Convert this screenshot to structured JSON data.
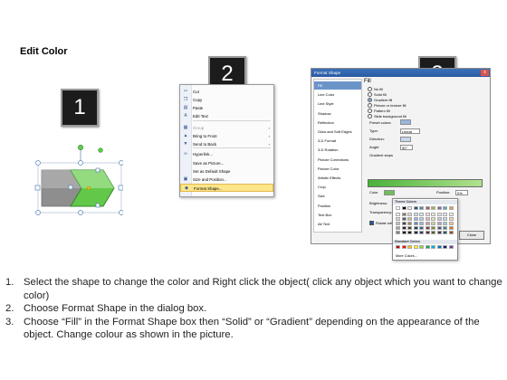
{
  "heading": "Edit Color",
  "badges": [
    "1",
    "2",
    "3"
  ],
  "shapes": {
    "left_color": "#8e8e8e",
    "right_color": "#62c84a"
  },
  "context_menu": {
    "items": [
      {
        "icon": "cut-icon",
        "glyph": "✂",
        "label": "Cut",
        "dim": false,
        "arrow": ""
      },
      {
        "icon": "copy-icon",
        "glyph": "❐",
        "label": "Copy",
        "dim": false,
        "arrow": ""
      },
      {
        "icon": "paste-icon",
        "glyph": "▤",
        "label": "Paste",
        "dim": false,
        "arrow": ""
      },
      {
        "icon": "edit-text-icon",
        "glyph": "A",
        "label": "Edit Text",
        "dim": false,
        "arrow": ""
      },
      {
        "icon": "group-icon",
        "glyph": "▦",
        "label": "Group",
        "dim": true,
        "arrow": "›"
      },
      {
        "icon": "bring-front-icon",
        "glyph": "▲",
        "label": "Bring to Front",
        "dim": false,
        "arrow": "›"
      },
      {
        "icon": "send-back-icon",
        "glyph": "▼",
        "label": "Send to Back",
        "dim": false,
        "arrow": "›"
      },
      {
        "icon": "hyperlink-icon",
        "glyph": "∞",
        "label": "Hyperlink...",
        "dim": false,
        "arrow": ""
      },
      {
        "icon": "save-picture-icon",
        "glyph": "",
        "label": "Save as Picture...",
        "dim": false,
        "arrow": ""
      },
      {
        "icon": "default-shape-icon",
        "glyph": "",
        "label": "Set as Default Shape",
        "dim": false,
        "arrow": ""
      },
      {
        "icon": "size-position-icon",
        "glyph": "▣",
        "label": "Size and Position...",
        "dim": false,
        "arrow": ""
      },
      {
        "icon": "format-shape-icon",
        "glyph": "◆",
        "label": "Format Shape...",
        "dim": false,
        "arrow": ""
      }
    ]
  },
  "dialog": {
    "title": "Format Shape",
    "close": "x",
    "side_items": [
      "Fill",
      "Line Color",
      "Line Style",
      "Shadow",
      "Reflection",
      "Glow and Soft Edges",
      "3-D Format",
      "3-D Rotation",
      "Picture Corrections",
      "Picture Color",
      "Artistic Effects",
      "Crop",
      "Size",
      "Position",
      "Text Box",
      "Alt Text"
    ],
    "pane_title": "Fill",
    "fill_options": [
      "No fill",
      "Solid fill",
      "Gradient fill",
      "Picture or texture fill",
      "Pattern fill",
      "Slide background fill"
    ],
    "selected_fill": "Gradient fill",
    "labels": {
      "preset": "Preset colors:",
      "type": "Type:",
      "type_value": "Linear",
      "direction": "Direction:",
      "angle": "Angle:",
      "angle_value": "90°",
      "stops": "Gradient stops",
      "color": "Color",
      "position": "Position:",
      "position_value": "0%",
      "brightness": "Brightness:",
      "transparency": "Transparency:",
      "rotate": "Rotate with shape"
    },
    "close_button": "Close"
  },
  "palette": {
    "theme_label": "Theme Colors",
    "standard_label": "Standard Colors",
    "more": "More Colors...",
    "theme_top": [
      "#ffffff",
      "#000000",
      "#eeece1",
      "#1f497d",
      "#4f81bd",
      "#c0504d",
      "#9bbb59",
      "#8064a2",
      "#4bacc6",
      "#f79646"
    ],
    "theme_rows": [
      [
        "#f2f2f2",
        "#7f7f7f",
        "#ddd9c3",
        "#c6d9f0",
        "#dbe5f1",
        "#f2dcdb",
        "#ebf1dd",
        "#e5e0ec",
        "#dbeef3",
        "#fdeada"
      ],
      [
        "#d8d8d8",
        "#595959",
        "#c4bd97",
        "#8db3e2",
        "#b8cce4",
        "#e5b9b7",
        "#d7e3bc",
        "#ccc1d9",
        "#b7dde8",
        "#fbd5b5"
      ],
      [
        "#bfbfbf",
        "#3f3f3f",
        "#938953",
        "#548dd4",
        "#95b3d7",
        "#d99694",
        "#c3d69b",
        "#b2a2c7",
        "#92cddc",
        "#fac08f"
      ],
      [
        "#a5a5a5",
        "#262626",
        "#494429",
        "#17365d",
        "#366092",
        "#953734",
        "#76923c",
        "#5f497a",
        "#31859b",
        "#e36c09"
      ],
      [
        "#7f7f7f",
        "#0c0c0c",
        "#1d1b10",
        "#0f243e",
        "#244061",
        "#632423",
        "#4f6128",
        "#3f3151",
        "#205867",
        "#974806"
      ]
    ],
    "standard": [
      "#c00000",
      "#ff0000",
      "#ffc000",
      "#ffff00",
      "#92d050",
      "#00b050",
      "#00b0f0",
      "#0070c0",
      "#002060",
      "#7030a0"
    ]
  },
  "steps": [
    {
      "num": "1.",
      "text": "Select the shape to change the color and Right click the object( click any object which you want to change color)"
    },
    {
      "num": "2.",
      "text": "Choose Format Shape in the dialog box."
    },
    {
      "num": "3.",
      "text": "Choose “Fill” in the Format Shape box then “Solid” or “Gradient” depending on the appearance of the object. Change colour as shown in the picture."
    }
  ]
}
